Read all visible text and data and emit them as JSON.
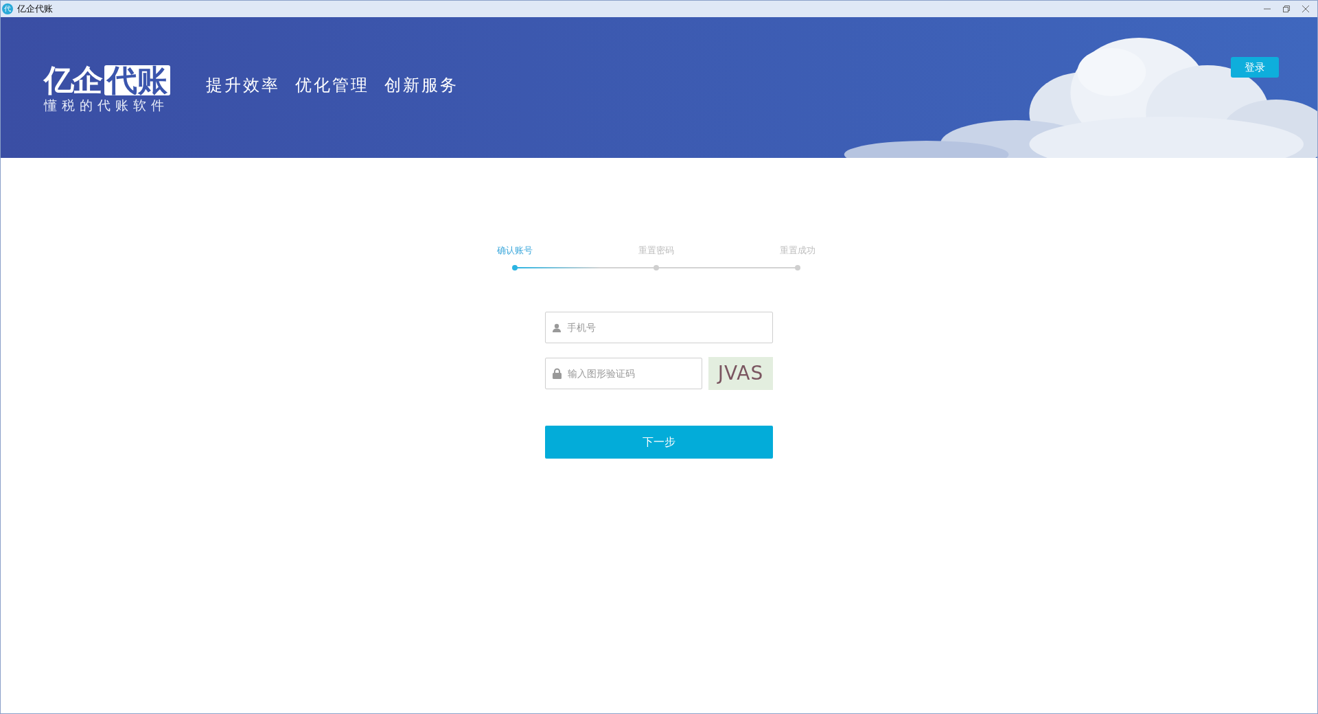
{
  "window": {
    "title": "亿企代账",
    "app_icon": "代"
  },
  "banner": {
    "kind": "picture",
    "logo": {
      "main": "亿企",
      "boxed": "代账",
      "tagline": "懂税的代账软件"
    },
    "slogans": [
      "提升效率",
      "优化管理",
      "创新服务"
    ],
    "login_button": "登录"
  },
  "steps": [
    {
      "label": "确认账号",
      "selected": true
    },
    {
      "label": "重置密码",
      "selected": false
    },
    {
      "label": "重置成功",
      "selected": false
    }
  ],
  "form": {
    "phone": {
      "placeholder": "手机号"
    },
    "captcha": {
      "placeholder": "输入图形验证码",
      "image_text": "JVAS"
    },
    "next_button": "下一步"
  }
}
